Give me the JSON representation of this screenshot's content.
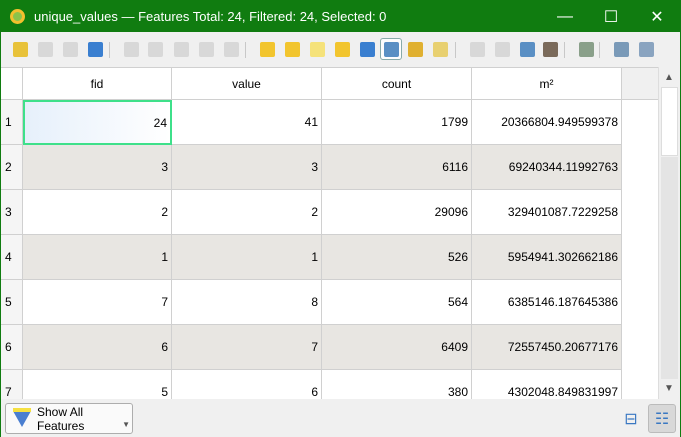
{
  "window": {
    "title": "unique_values — Features Total: 24, Filtered: 24, Selected: 0",
    "minimize": "—",
    "maximize": "☐",
    "close": "✕"
  },
  "toolbar": {
    "items": [
      {
        "name": "toggle-editing",
        "color": "#e8c23a",
        "enabled": true
      },
      {
        "name": "toggle-multi-edit",
        "color": "#c8c8c8",
        "enabled": false
      },
      {
        "name": "save-edits",
        "color": "#c8c8c8",
        "enabled": false
      },
      {
        "name": "reload",
        "color": "#3a7fd0",
        "enabled": true
      },
      {
        "name": "add-feature",
        "color": "#c8c8c8",
        "enabled": false
      },
      {
        "name": "delete-selected",
        "color": "#c8c8c8",
        "enabled": false
      },
      {
        "name": "cut",
        "color": "#c8c8c8",
        "enabled": false
      },
      {
        "name": "copy",
        "color": "#c8c8c8",
        "enabled": false
      },
      {
        "name": "paste",
        "color": "#c8c8c8",
        "enabled": false
      },
      {
        "name": "select-by-expression",
        "color": "#f2c52e",
        "enabled": true
      },
      {
        "name": "select-all",
        "color": "#f2c52e",
        "enabled": true
      },
      {
        "name": "invert-selection",
        "color": "#f5e27a",
        "enabled": true
      },
      {
        "name": "deselect-all",
        "color": "#f2c52e",
        "enabled": true
      },
      {
        "name": "filter-select",
        "color": "#3a7fd0",
        "enabled": true
      },
      {
        "name": "move-selection-to-top",
        "color": "#5a8fc4",
        "enabled": true,
        "selected": true
      },
      {
        "name": "pan-to-selected",
        "color": "#e0b030",
        "enabled": true
      },
      {
        "name": "zoom-to-selected",
        "color": "#e8d070",
        "enabled": true
      },
      {
        "name": "new-field",
        "color": "#c8c8c8",
        "enabled": false
      },
      {
        "name": "delete-field",
        "color": "#c8c8c8",
        "enabled": false
      },
      {
        "name": "field-calculator-edit",
        "color": "#5a8fc4",
        "enabled": true
      },
      {
        "name": "field-calculator",
        "color": "#7a6a5a",
        "enabled": true
      },
      {
        "name": "conditional-formatting",
        "color": "#8aa08a",
        "enabled": true
      },
      {
        "name": "dock-attribute-table",
        "color": "#7a9ab8",
        "enabled": true
      },
      {
        "name": "actions",
        "color": "#8aa4c0",
        "enabled": true
      }
    ]
  },
  "table": {
    "columns": [
      "fid",
      "value",
      "count",
      "m²"
    ],
    "rows": [
      {
        "n": "1",
        "cells": [
          "24",
          "41",
          "1799",
          "20366804.949599378"
        ]
      },
      {
        "n": "2",
        "cells": [
          "3",
          "3",
          "6116",
          "69240344.11992763"
        ]
      },
      {
        "n": "3",
        "cells": [
          "2",
          "2",
          "29096",
          "329401087.7229258"
        ]
      },
      {
        "n": "4",
        "cells": [
          "1",
          "1",
          "526",
          "5954941.302662186"
        ]
      },
      {
        "n": "5",
        "cells": [
          "7",
          "8",
          "564",
          "6385146.187645386"
        ]
      },
      {
        "n": "6",
        "cells": [
          "6",
          "7",
          "6409",
          "72557450.20677176"
        ]
      },
      {
        "n": "7",
        "cells": [
          "5",
          "6",
          "380",
          "4302048.849831997"
        ]
      }
    ]
  },
  "scrollbar": {
    "up": "▲",
    "down": "▼"
  },
  "bottom": {
    "filter_label": "Show All Features",
    "caret": "▼",
    "form_view_icon": "⊟",
    "table_view_icon": "☷"
  }
}
